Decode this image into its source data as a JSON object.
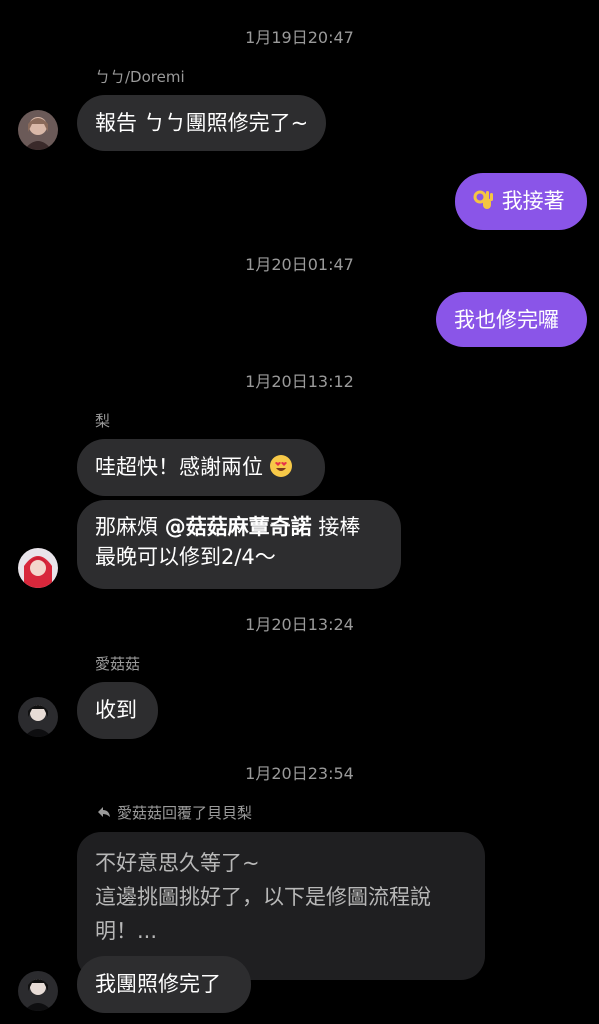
{
  "messages": {
    "ts1": "1月19日20:47",
    "sender1": "ㄅㄅ/Doremi",
    "msg1": "報告 ㄅㄅ團照修完了~",
    "out1": "我接著",
    "ts2": "1月20日01:47",
    "out2": "我也修完囉",
    "ts3": "1月20日13:12",
    "sender2": "梨",
    "msg2": "哇超快！感謝兩位",
    "msg3_pre": "那麻煩 ",
    "msg3_mention": "@菇菇麻蕈奇諾",
    "msg3_post": " 接棒",
    "msg3_line2": "最晚可以修到2/4～",
    "ts4": "1月20日13:24",
    "sender3": "愛菇菇",
    "msg4": "收到",
    "ts5": "1月20日23:54",
    "reply_label": "愛菇菇回覆了貝貝梨",
    "quoted_line1": "不好意思久等了~",
    "quoted_line2": "這邊挑圖挑好了，以下是修圖流程說",
    "quoted_line3": "明！...",
    "msg5": "我團照修完了"
  },
  "icons": {
    "ok_hand": "ok-hand-emoji",
    "heart_eyes": "heart-eyes-emoji",
    "reply_arrow": "reply-arrow-icon"
  },
  "colors": {
    "background": "#000000",
    "incoming_bubble": "#2d2d2f",
    "outgoing_bubble": "#8a55e8",
    "meta_text": "#9a9a9a"
  }
}
